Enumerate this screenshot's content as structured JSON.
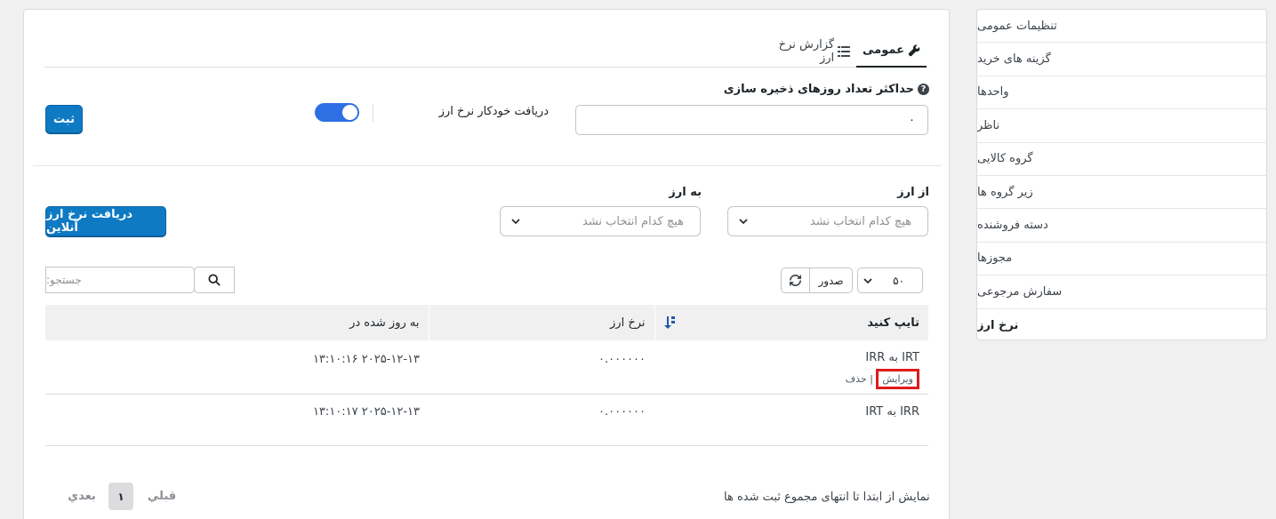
{
  "sidebar": {
    "items": [
      {
        "label": "تنظیمات عمومی"
      },
      {
        "label": "گزینه های خرید"
      },
      {
        "label": "واحدها"
      },
      {
        "label": "ناظر"
      },
      {
        "label": "گروه کالایی"
      },
      {
        "label": "زیر گروه ها"
      },
      {
        "label": "دسته فروشنده"
      },
      {
        "label": "مجوزها"
      },
      {
        "label": "سفارش مرجوعی"
      },
      {
        "label": "نرخ ارز"
      }
    ],
    "active_index": 9
  },
  "tabs": {
    "general": "عمومی",
    "report": "گزارش نرخ ارز"
  },
  "settings": {
    "max_days_label": "حداکثر تعداد روزهای ذخیره سازی",
    "max_days_value": "۰",
    "auto_fetch_label": "دریافت خودکار نرخ ارز",
    "auto_fetch_on": true,
    "submit_label": "ثبت"
  },
  "currency": {
    "from_label": "از ارز",
    "to_label": "به ارز",
    "from_placeholder": "هیچ کدام انتخاب نشد",
    "to_placeholder": "هیچ کدام انتخاب نشد",
    "fetch_online_label": "دریافت نرخ ارز آنلاین"
  },
  "table_controls": {
    "page_size": "۵۰",
    "export_label": "صدور",
    "search_placeholder": "جستجو:"
  },
  "table": {
    "headers": [
      "تایپ کنید",
      "نرخ ارز",
      "به روز شده در"
    ],
    "rows": [
      {
        "type": "IRT به IRR",
        "rate": "۰.۰۰۰۰۰۰",
        "updated": "۲۰۲۵-۱۲-۱۳ ۱۳:۱۰:۱۶",
        "edit": "ویرایش",
        "delete": "حذف",
        "separator": "|"
      },
      {
        "type": "IRR به IRT",
        "rate": "۰.۰۰۰۰۰۰",
        "updated": "۲۰۲۵-۱۲-۱۳ ۱۳:۱۰:۱۷"
      }
    ]
  },
  "footer": {
    "info": "نمایش از ابتدا تا انتهای مجموع ثبت شده ها",
    "prev": "قبلي",
    "page": "۱",
    "next": "بعدي"
  },
  "colors": {
    "primary_button": "#0f7ac4",
    "toggle_on": "#2f6fe4",
    "highlight_box": "#e01b1b"
  }
}
